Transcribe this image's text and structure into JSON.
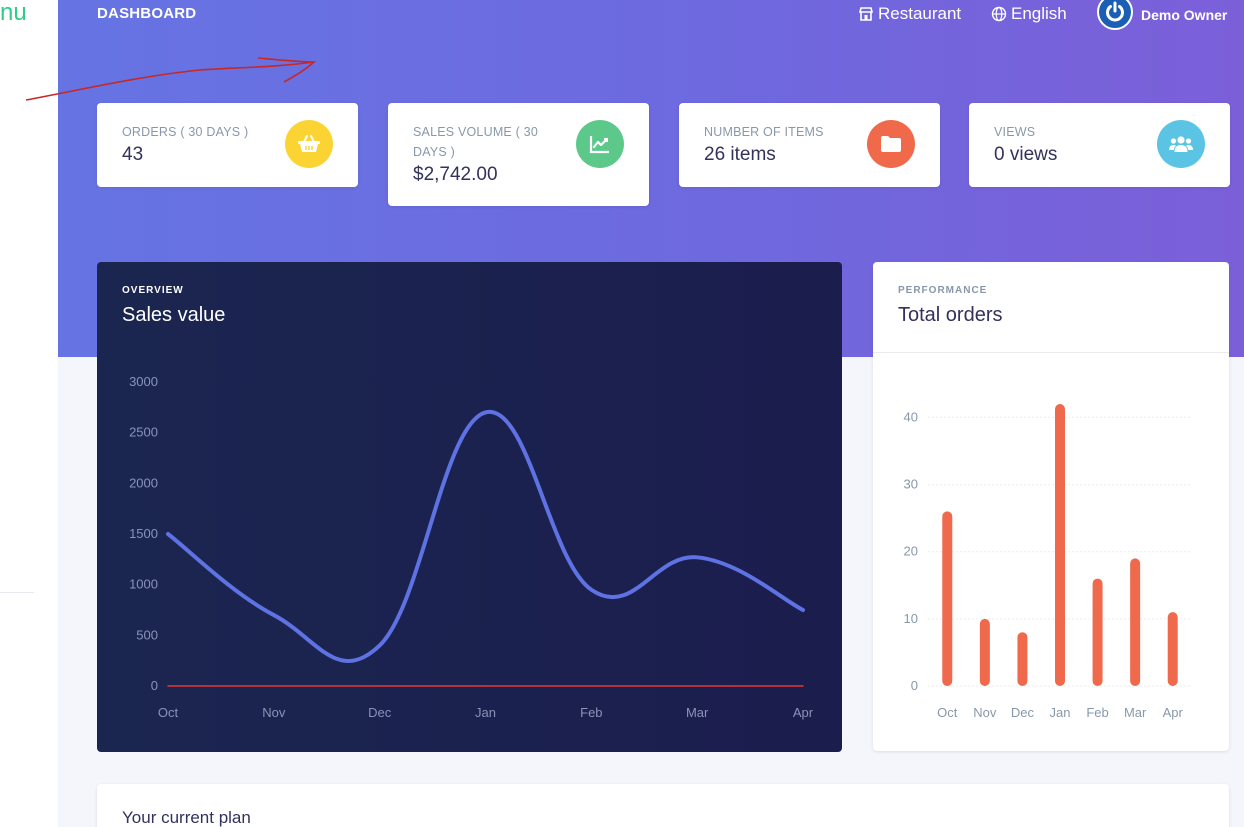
{
  "sidebar": {
    "fragment_text": "nu"
  },
  "header": {
    "brand": "DASHBOARD",
    "restaurant_label": "Restaurant",
    "language_label": "English",
    "user_name": "Demo Owner"
  },
  "stats": [
    {
      "label": "ORDERS ( 30 DAYS )",
      "value": "43",
      "icon": "basket-icon",
      "color": "#fbd433"
    },
    {
      "label": "SALES VOLUME ( 30 DAYS )",
      "value": "$2,742.00",
      "icon": "chart-line-icon",
      "color": "#5cc98b"
    },
    {
      "label": "NUMBER OF ITEMS",
      "value": "26 items",
      "icon": "folder-icon",
      "color": "#f0694a"
    },
    {
      "label": "VIEWS",
      "value": "0 views",
      "icon": "users-icon",
      "color": "#5bc4e4"
    }
  ],
  "sales_chart": {
    "overline": "OVERVIEW",
    "title": "Sales value"
  },
  "orders_chart": {
    "overline": "PERFORMANCE",
    "title": "Total orders"
  },
  "plan": {
    "title": "Your current plan"
  },
  "chart_data": [
    {
      "type": "line",
      "title": "Sales value",
      "categories": [
        "Oct",
        "Nov",
        "Dec",
        "Jan",
        "Feb",
        "Mar",
        "Apr"
      ],
      "series": [
        {
          "values": [
            1500,
            700,
            400,
            2700,
            950,
            1270,
            750
          ],
          "color": "#5e72e4"
        },
        {
          "values": [
            0,
            0,
            0,
            0,
            0,
            0,
            0
          ],
          "color": "#e53935"
        }
      ],
      "yticks": [
        0,
        500,
        1000,
        1500,
        2000,
        2500,
        3000
      ],
      "ylim": [
        0,
        3000
      ],
      "smooth": true,
      "grid": false
    },
    {
      "type": "bar",
      "title": "Total orders",
      "categories": [
        "Oct",
        "Nov",
        "Dec",
        "Jan",
        "Feb",
        "Mar",
        "Apr"
      ],
      "values": [
        26,
        10,
        8,
        42,
        16,
        19,
        11
      ],
      "color": "#ef6a4c",
      "yticks": [
        0,
        10,
        20,
        30,
        40
      ],
      "ylim": [
        0,
        42
      ],
      "grid": true
    }
  ]
}
